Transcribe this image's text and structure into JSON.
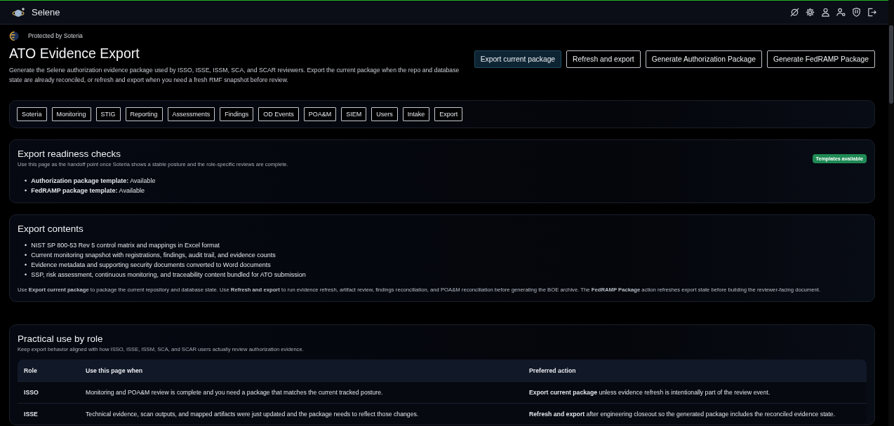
{
  "app": {
    "title": "Selene"
  },
  "brand": {
    "text": "Protected by Soteria"
  },
  "page": {
    "title": "ATO Evidence Export",
    "description": "Generate the Selene authorization evidence package used by ISSO, ISSE, ISSM, SCA, and SCAR reviewers. Export the current package when the repo and database state are already reconciled, or refresh and export when you need a fresh RMF snapshot before review."
  },
  "actions": [
    {
      "label": "Export current package",
      "kind": "primary"
    },
    {
      "label": "Refresh and export",
      "kind": "outline"
    },
    {
      "label": "Generate Authorization Package",
      "kind": "outline"
    },
    {
      "label": "Generate FedRAMP Package",
      "kind": "outline"
    }
  ],
  "nav": [
    "Soteria",
    "Monitoring",
    "STIG",
    "Reporting",
    "Assessments",
    "Findings",
    "OD Events",
    "POA&M",
    "SIEM",
    "Users",
    "Intake",
    "Export"
  ],
  "readiness": {
    "title": "Export readiness checks",
    "subtitle": "Use this page as the handoff point once Soteria shows a stable posture and the role-specific reviews are complete.",
    "badge": "Templates available",
    "items": [
      {
        "bullet": "•",
        "text": "**Authorization package template:** Available"
      },
      {
        "bullet": "•",
        "text": "**FedRAMP package template:** Available"
      }
    ]
  },
  "contents": {
    "title": "Export contents",
    "items": [
      {
        "bullet": "•",
        "text": "NIST SP 800-53 Rev 5 control matrix and mappings in Excel format"
      },
      {
        "bullet": "•",
        "text": "Current monitoring snapshot with registrations, findings, audit trail, and evidence counts"
      },
      {
        "bullet": "•",
        "text": "Evidence metadata and supporting security documents converted to Word documents"
      },
      {
        "bullet": "•",
        "text": "SSP, risk assessment, continuous monitoring, and traceability content bundled for ATO submission"
      }
    ],
    "note": "Use **Export current package** to package the current repository and database state. Use **Refresh and export** to run evidence refresh, artifact review, findings reconciliation, and POA&M reconciliation before generating the BOE archive. The **FedRAMP Package** action refreshes export state before building the reviewer-facing document."
  },
  "roles": {
    "title": "Practical use by role",
    "subtitle": "Keep export behavior aligned with how ISSO, ISSE, ISSM, SCA, and SCAR users actually review authorization evidence.",
    "columns": [
      "Role",
      "Use this page when",
      "Preferred action"
    ],
    "rows": [
      {
        "role": "ISSO",
        "when": "Monitoring and POA&M review is complete and you need a package that matches the current tracked posture.",
        "action": "**Export current package** unless evidence refresh is intentionally part of the review event."
      },
      {
        "role": "ISSE",
        "when": "Technical evidence, scan outputs, and mapped artifacts were just updated and the package needs to reflect those changes.",
        "action": "**Refresh and export** after engineering closeout so the generated package includes the reconciled evidence state."
      }
    ]
  }
}
